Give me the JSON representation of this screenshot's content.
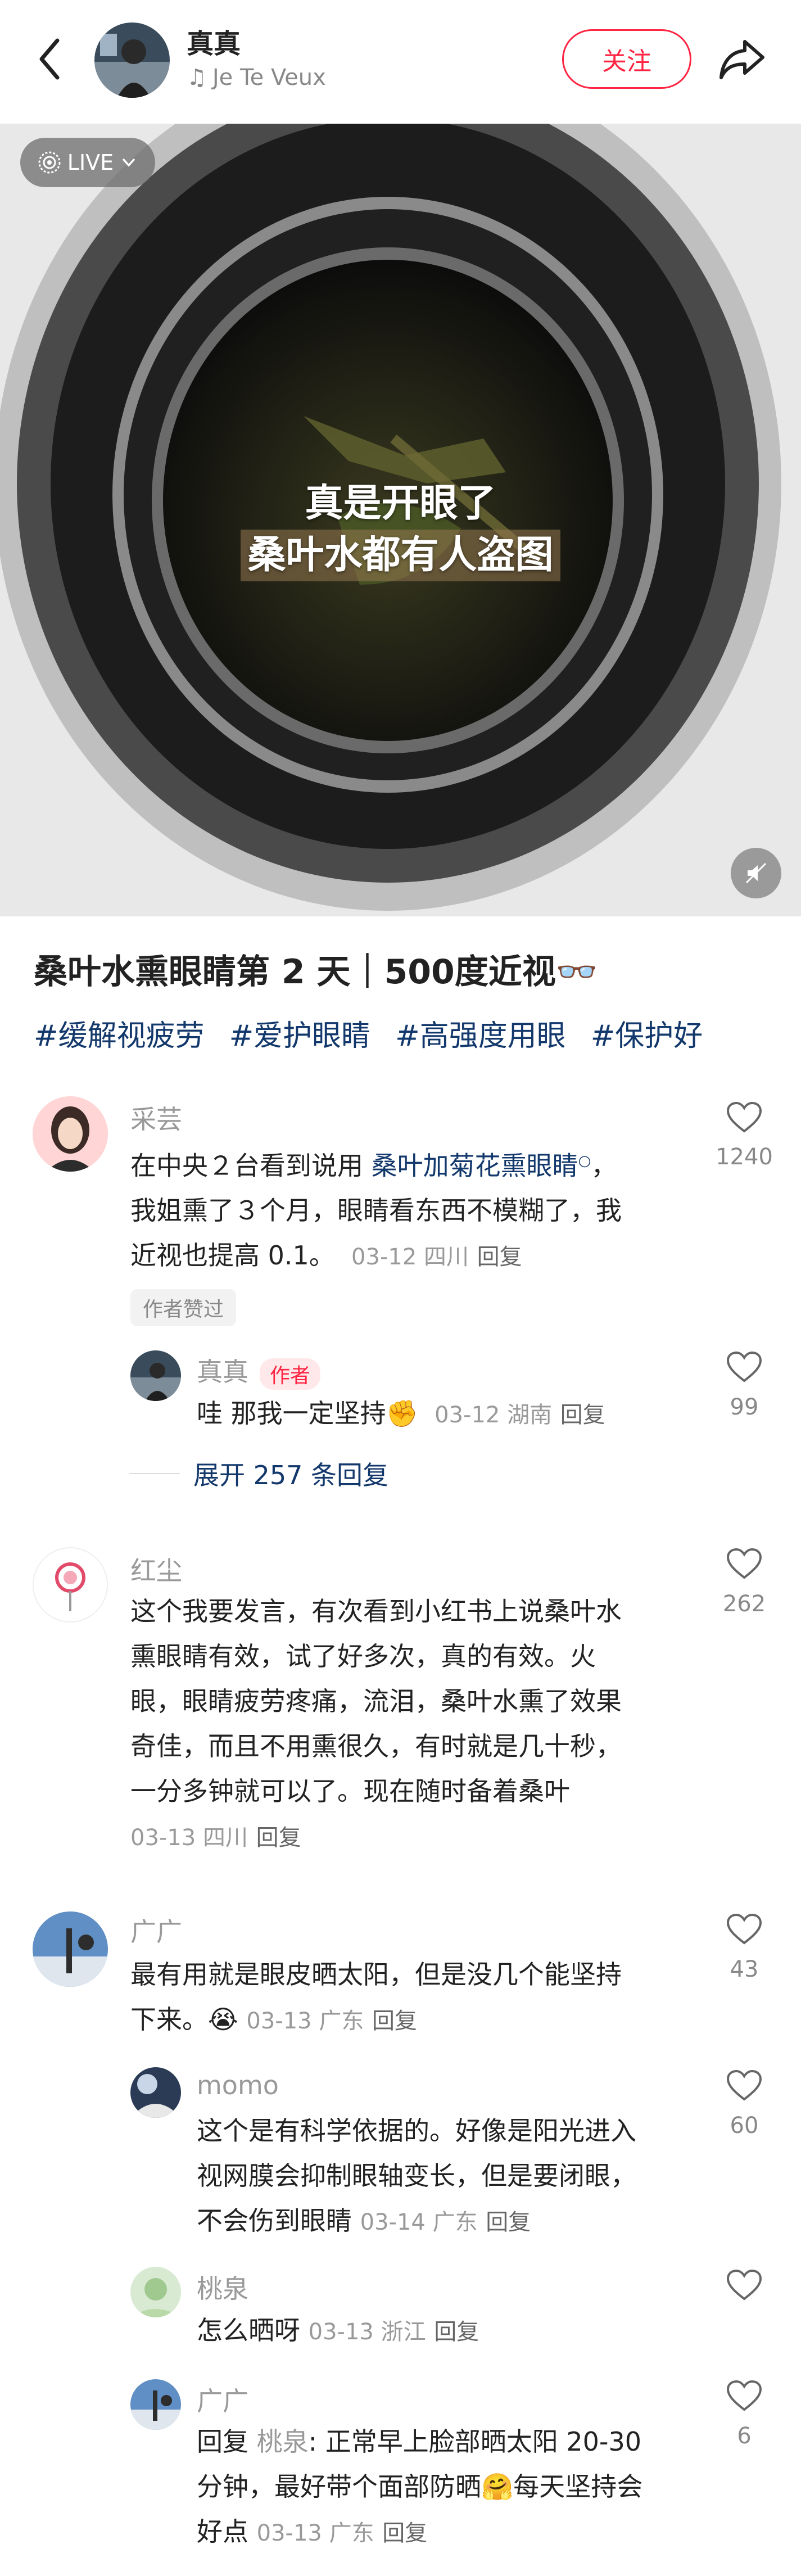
{
  "header": {
    "author_name": "真真",
    "music_note": "♫",
    "music_title": "Je Te Veux",
    "follow_label": "关注",
    "accent": "#ff2442"
  },
  "photo": {
    "live_label": "LIVE",
    "overlay_line1": "真是开眼了",
    "overlay_line2": "桑叶水都有人盗图"
  },
  "post": {
    "title": "桑叶水熏眼睛第  2  天｜500度近视👓",
    "tags": [
      "#缓解视疲劳",
      "#爱护眼睛",
      "#高强度用眼",
      "#保护好"
    ]
  },
  "comments": {
    "c1": {
      "name": "采芸",
      "line1_pre": "在中央２台看到说用 ",
      "line1_link": "桑叶加菊花熏眼睛",
      "line1_post": "，",
      "line2": "我姐熏了３个月，眼睛看东西不模糊了，我",
      "line3": "近视也提高 0.1。",
      "meta": "03-12 四川",
      "reply": "回复",
      "likes": "1240",
      "liked_badge": "作者赞过"
    },
    "c1r1": {
      "name": "真真",
      "badge": "作者",
      "text": "哇 那我一定坚持✊",
      "meta": "03-12 湖南",
      "reply": "回复",
      "likes": "99"
    },
    "expand_label": "展开 257 条回复",
    "c2": {
      "name": "红尘",
      "lines": [
        "这个我要发言，有次看到小红书上说桑叶水",
        "熏眼睛有效，试了好多次，真的有效。火",
        "眼，眼睛疲劳疼痛，流泪，桑叶水熏了效果",
        "奇佳，而且不用熏很久，有时就是几十秒，",
        "一分多钟就可以了。现在随时备着桑叶"
      ],
      "meta": "03-13 四川",
      "reply": "回复",
      "likes": "262"
    },
    "c3": {
      "name": "广广",
      "line1": "最有用就是眼皮晒太阳，但是没几个能坚持",
      "line2": "下来。😭",
      "meta": "03-13 广东",
      "reply": "回复",
      "likes": "43"
    },
    "c3r1": {
      "name": "momo",
      "lines": [
        "这个是有科学依据的。好像是阳光进入",
        "视网膜会抑制眼轴变长，但是要闭眼，"
      ],
      "line3": "不会伤到眼睛",
      "meta": "03-14 广东",
      "reply": "回复",
      "likes": "60"
    },
    "c3r2": {
      "name": "桃泉",
      "text": "怎么晒呀",
      "meta": "03-13 浙江",
      "reply": "回复"
    },
    "c3r3": {
      "name": "广广",
      "reply_prefix": "回复 ",
      "reply_to": "桃泉",
      "line1": ": 正常早上脸部晒太阳 20-30",
      "line2": "分钟，最好带个面部防晒🤗每天坚持会",
      "line3": "好点",
      "meta": "03-13 广东",
      "reply": "回复",
      "likes": "6"
    }
  }
}
